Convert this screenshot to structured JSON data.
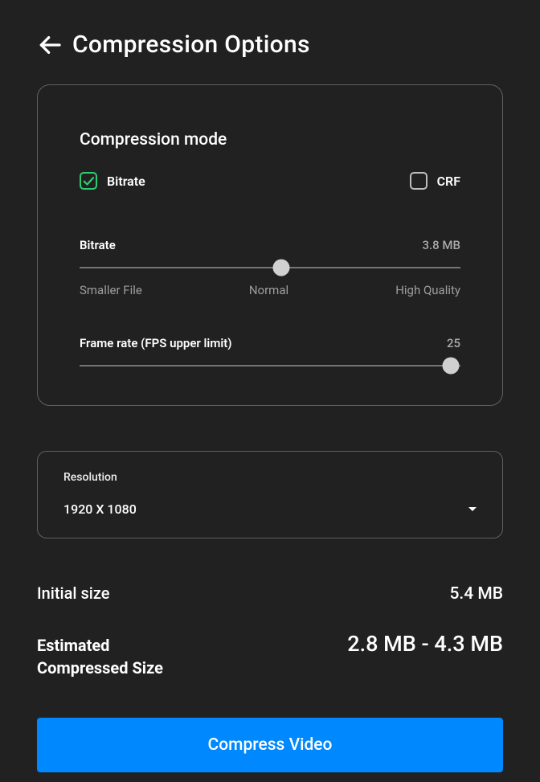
{
  "header": {
    "title": "Compression Options"
  },
  "compression": {
    "section_title": "Compression mode",
    "modes": {
      "bitrate_label": "Bitrate",
      "crf_label": "CRF"
    },
    "bitrate": {
      "label": "Bitrate",
      "value": "3.8 MB",
      "thumb_pct": 53,
      "ticks": {
        "low": "Smaller File",
        "mid": "Normal",
        "high": "High Quality"
      }
    },
    "framerate": {
      "label": "Frame rate (FPS upper limit)",
      "value": "25",
      "thumb_pct": 97.5
    }
  },
  "resolution": {
    "label": "Resolution",
    "value": "1920 X 1080"
  },
  "initial_size": {
    "label": "Initial size",
    "value": "5.4 MB"
  },
  "estimated": {
    "label_line1": "Estimated",
    "label_line2": "Compressed Size",
    "value": "2.8 MB - 4.3 MB"
  },
  "action": {
    "compress_label": "Compress Video"
  }
}
